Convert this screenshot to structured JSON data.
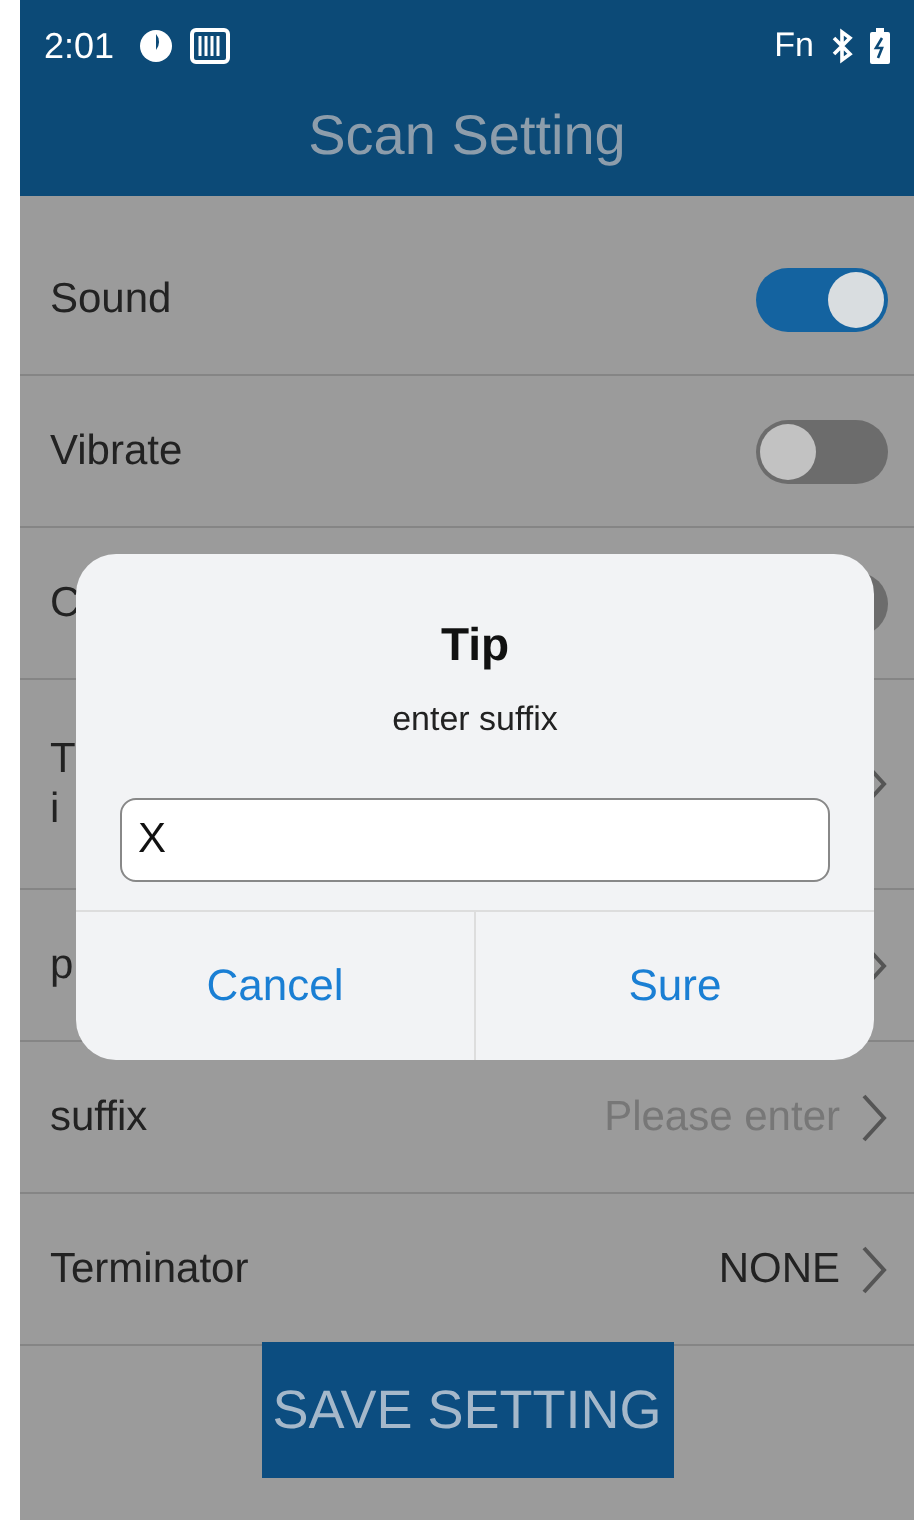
{
  "status_bar": {
    "time": "2:01",
    "fn": "Fn"
  },
  "title": "Scan Setting",
  "rows": [
    {
      "kind": "toggle",
      "label": "Sound",
      "on": true
    },
    {
      "kind": "toggle",
      "label": "Vibrate",
      "on": false
    },
    {
      "kind": "toggle",
      "label": "C",
      "on": false
    },
    {
      "kind": "link",
      "lines": [
        "T",
        "i"
      ]
    },
    {
      "kind": "link",
      "label": "p"
    },
    {
      "kind": "link",
      "label": "suffix",
      "hint": "Please enter"
    },
    {
      "kind": "link",
      "label": "Terminator",
      "value": "NONE"
    }
  ],
  "save_button": "SAVE SETTING",
  "dialog": {
    "title": "Tip",
    "message": "enter suffix",
    "value": "X",
    "buttons": [
      "Cancel",
      "Sure"
    ]
  }
}
